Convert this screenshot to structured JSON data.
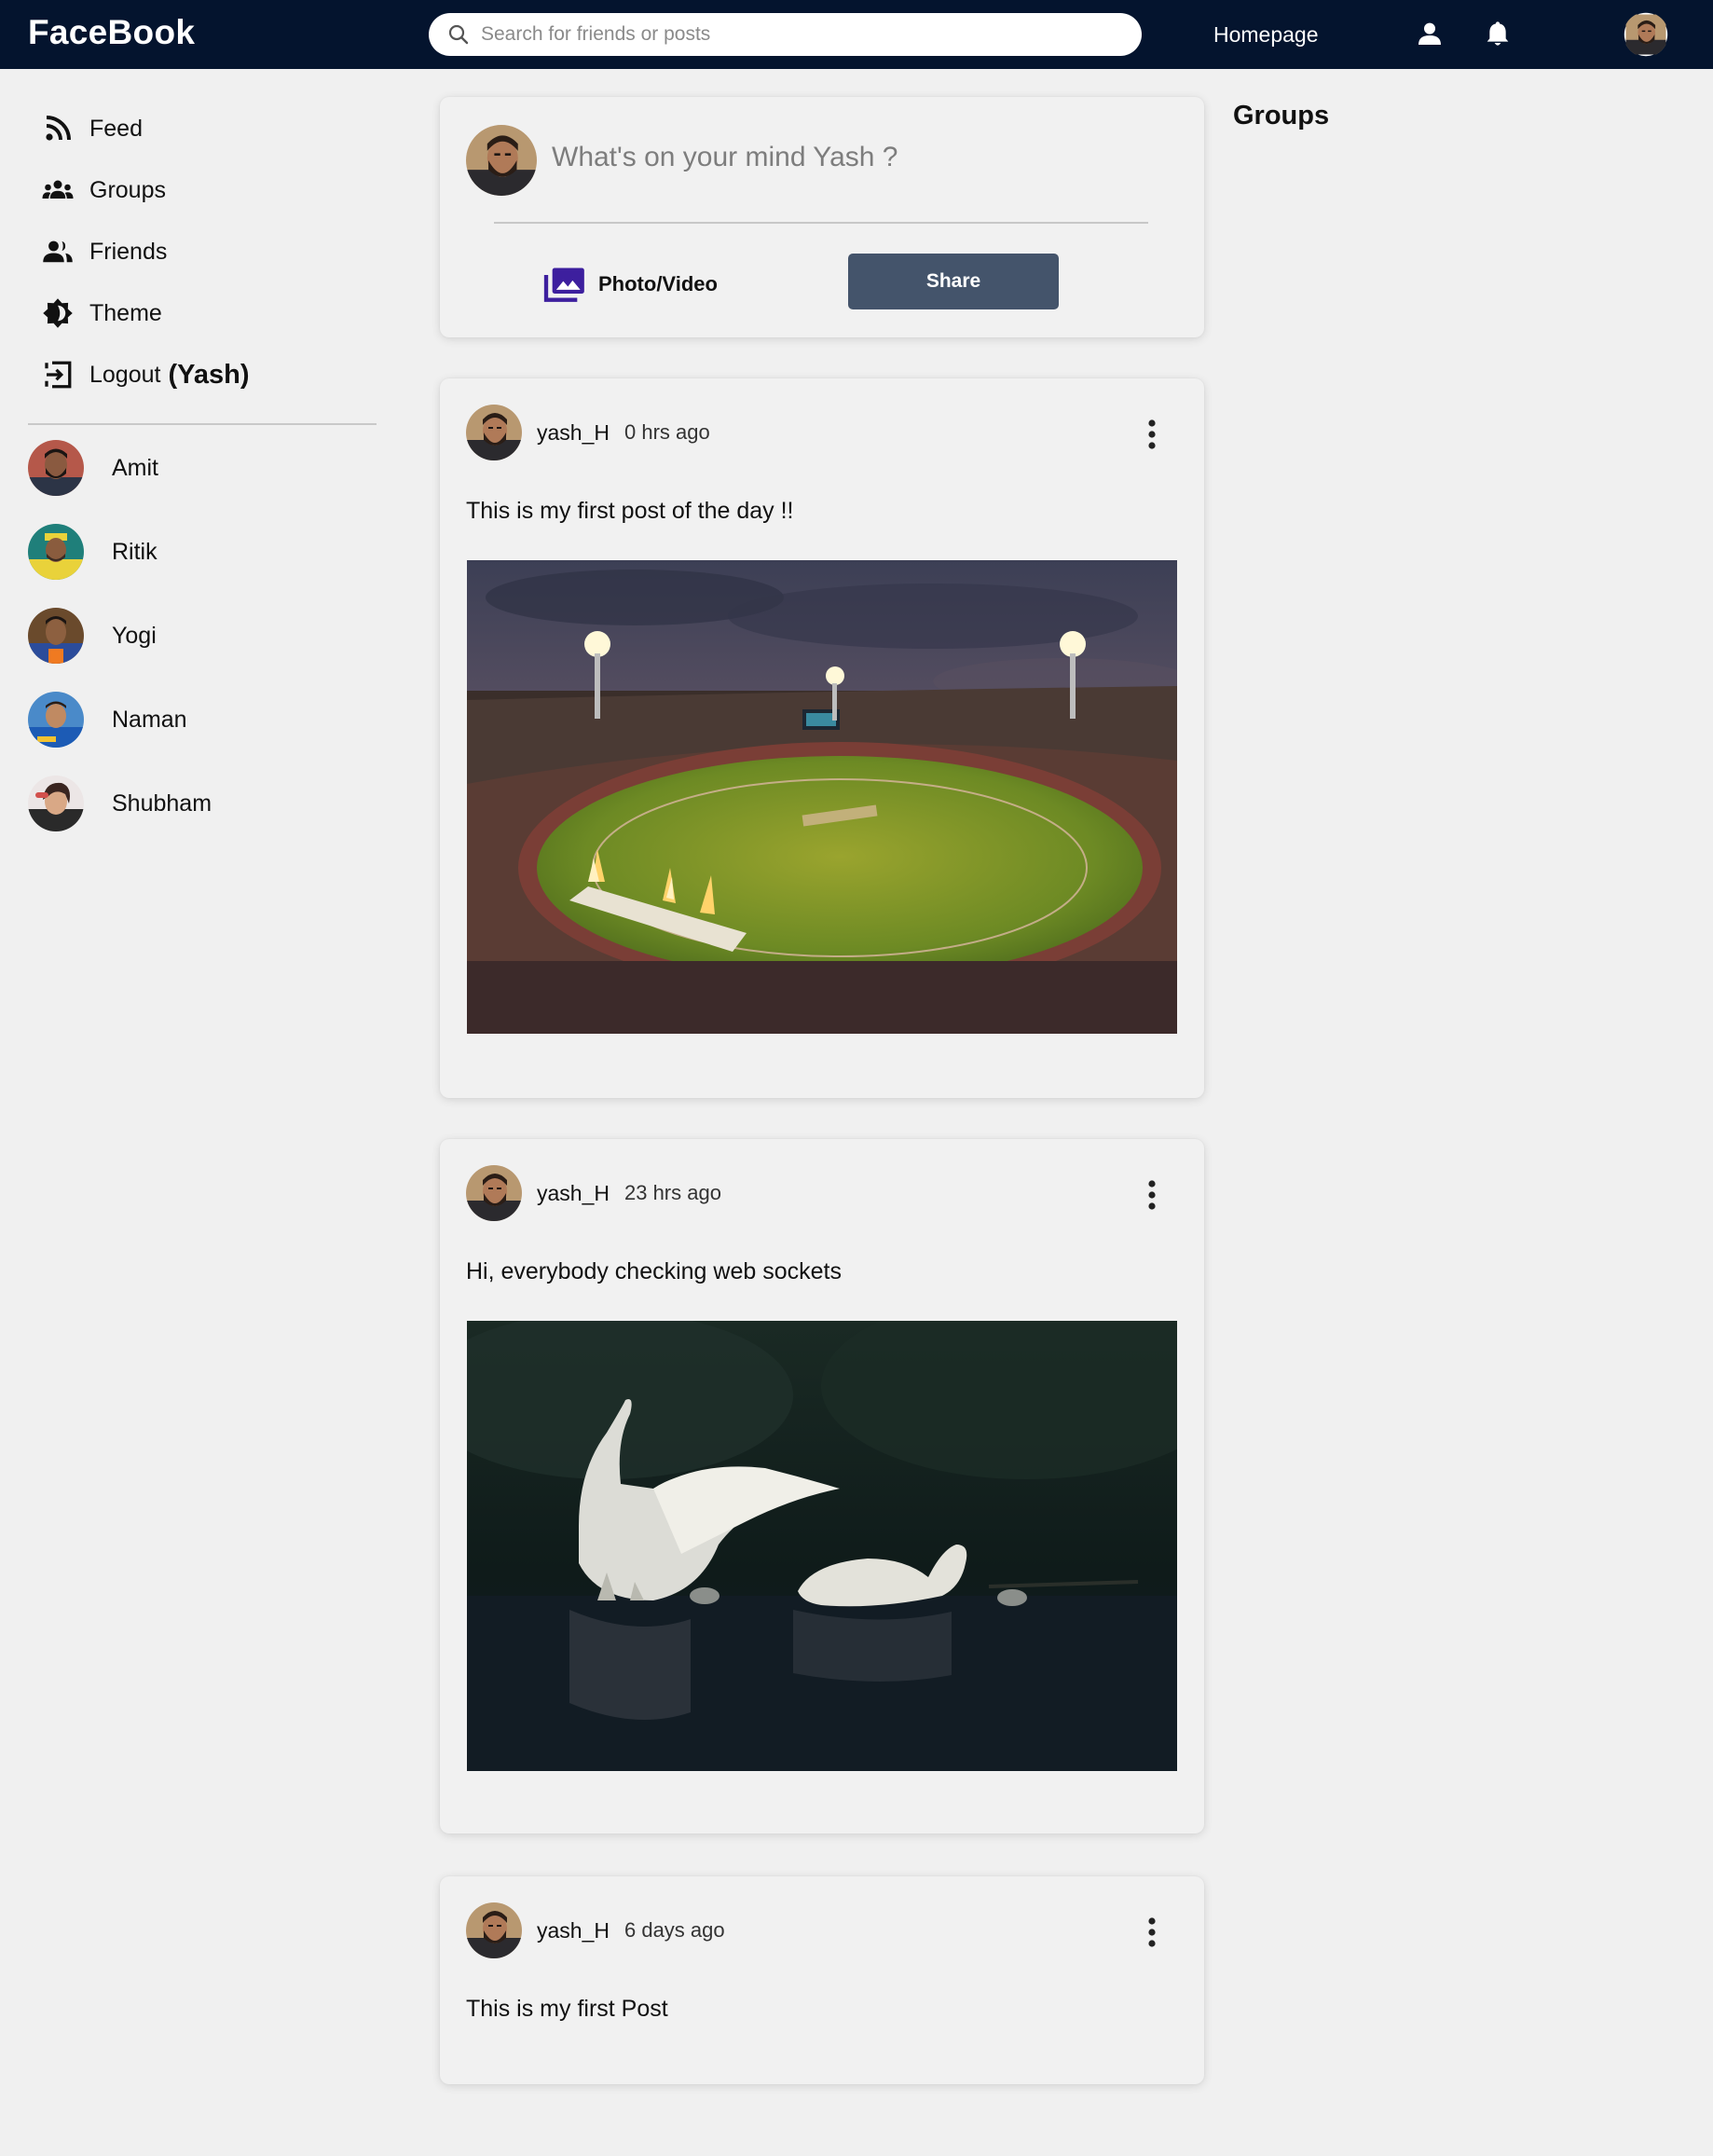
{
  "header": {
    "brand": "FaceBook",
    "search_placeholder": "Search for friends or posts",
    "nav_link": "Homepage",
    "icons": [
      "search-icon",
      "person-icon",
      "bell-icon"
    ],
    "background_color": "#04142e"
  },
  "sidebar": {
    "items": [
      {
        "label": "Feed",
        "icon": "rss-feed-icon"
      },
      {
        "label": "Groups",
        "icon": "groups-icon"
      },
      {
        "label": "Friends",
        "icon": "people-icon"
      },
      {
        "label": "Theme",
        "icon": "brightness-icon"
      },
      {
        "label": "Logout",
        "icon": "logout-icon",
        "extra": "(Yash)"
      }
    ],
    "friends": [
      {
        "name": "Amit"
      },
      {
        "name": "Ritik"
      },
      {
        "name": "Yogi"
      },
      {
        "name": "Naman"
      },
      {
        "name": "Shubham"
      }
    ]
  },
  "composer": {
    "placeholder": "What's on your mind Yash ?",
    "photo_label": "Photo/Video",
    "share_label": "Share",
    "photo_icon_color": "#3d1f9e",
    "share_button_color": "#44546b"
  },
  "posts": [
    {
      "username": "yash_H",
      "time": "0 hrs ago",
      "text": "This is my first post of the day !!",
      "image": "cricket-stadium-photo"
    },
    {
      "username": "yash_H",
      "time": "23 hrs ago",
      "text": "Hi, everybody checking web sockets",
      "image": "swans-on-lake-photo"
    },
    {
      "username": "yash_H",
      "time": "6 days ago",
      "text": "This is my first Post"
    }
  ],
  "right_panel": {
    "title": "Groups"
  }
}
